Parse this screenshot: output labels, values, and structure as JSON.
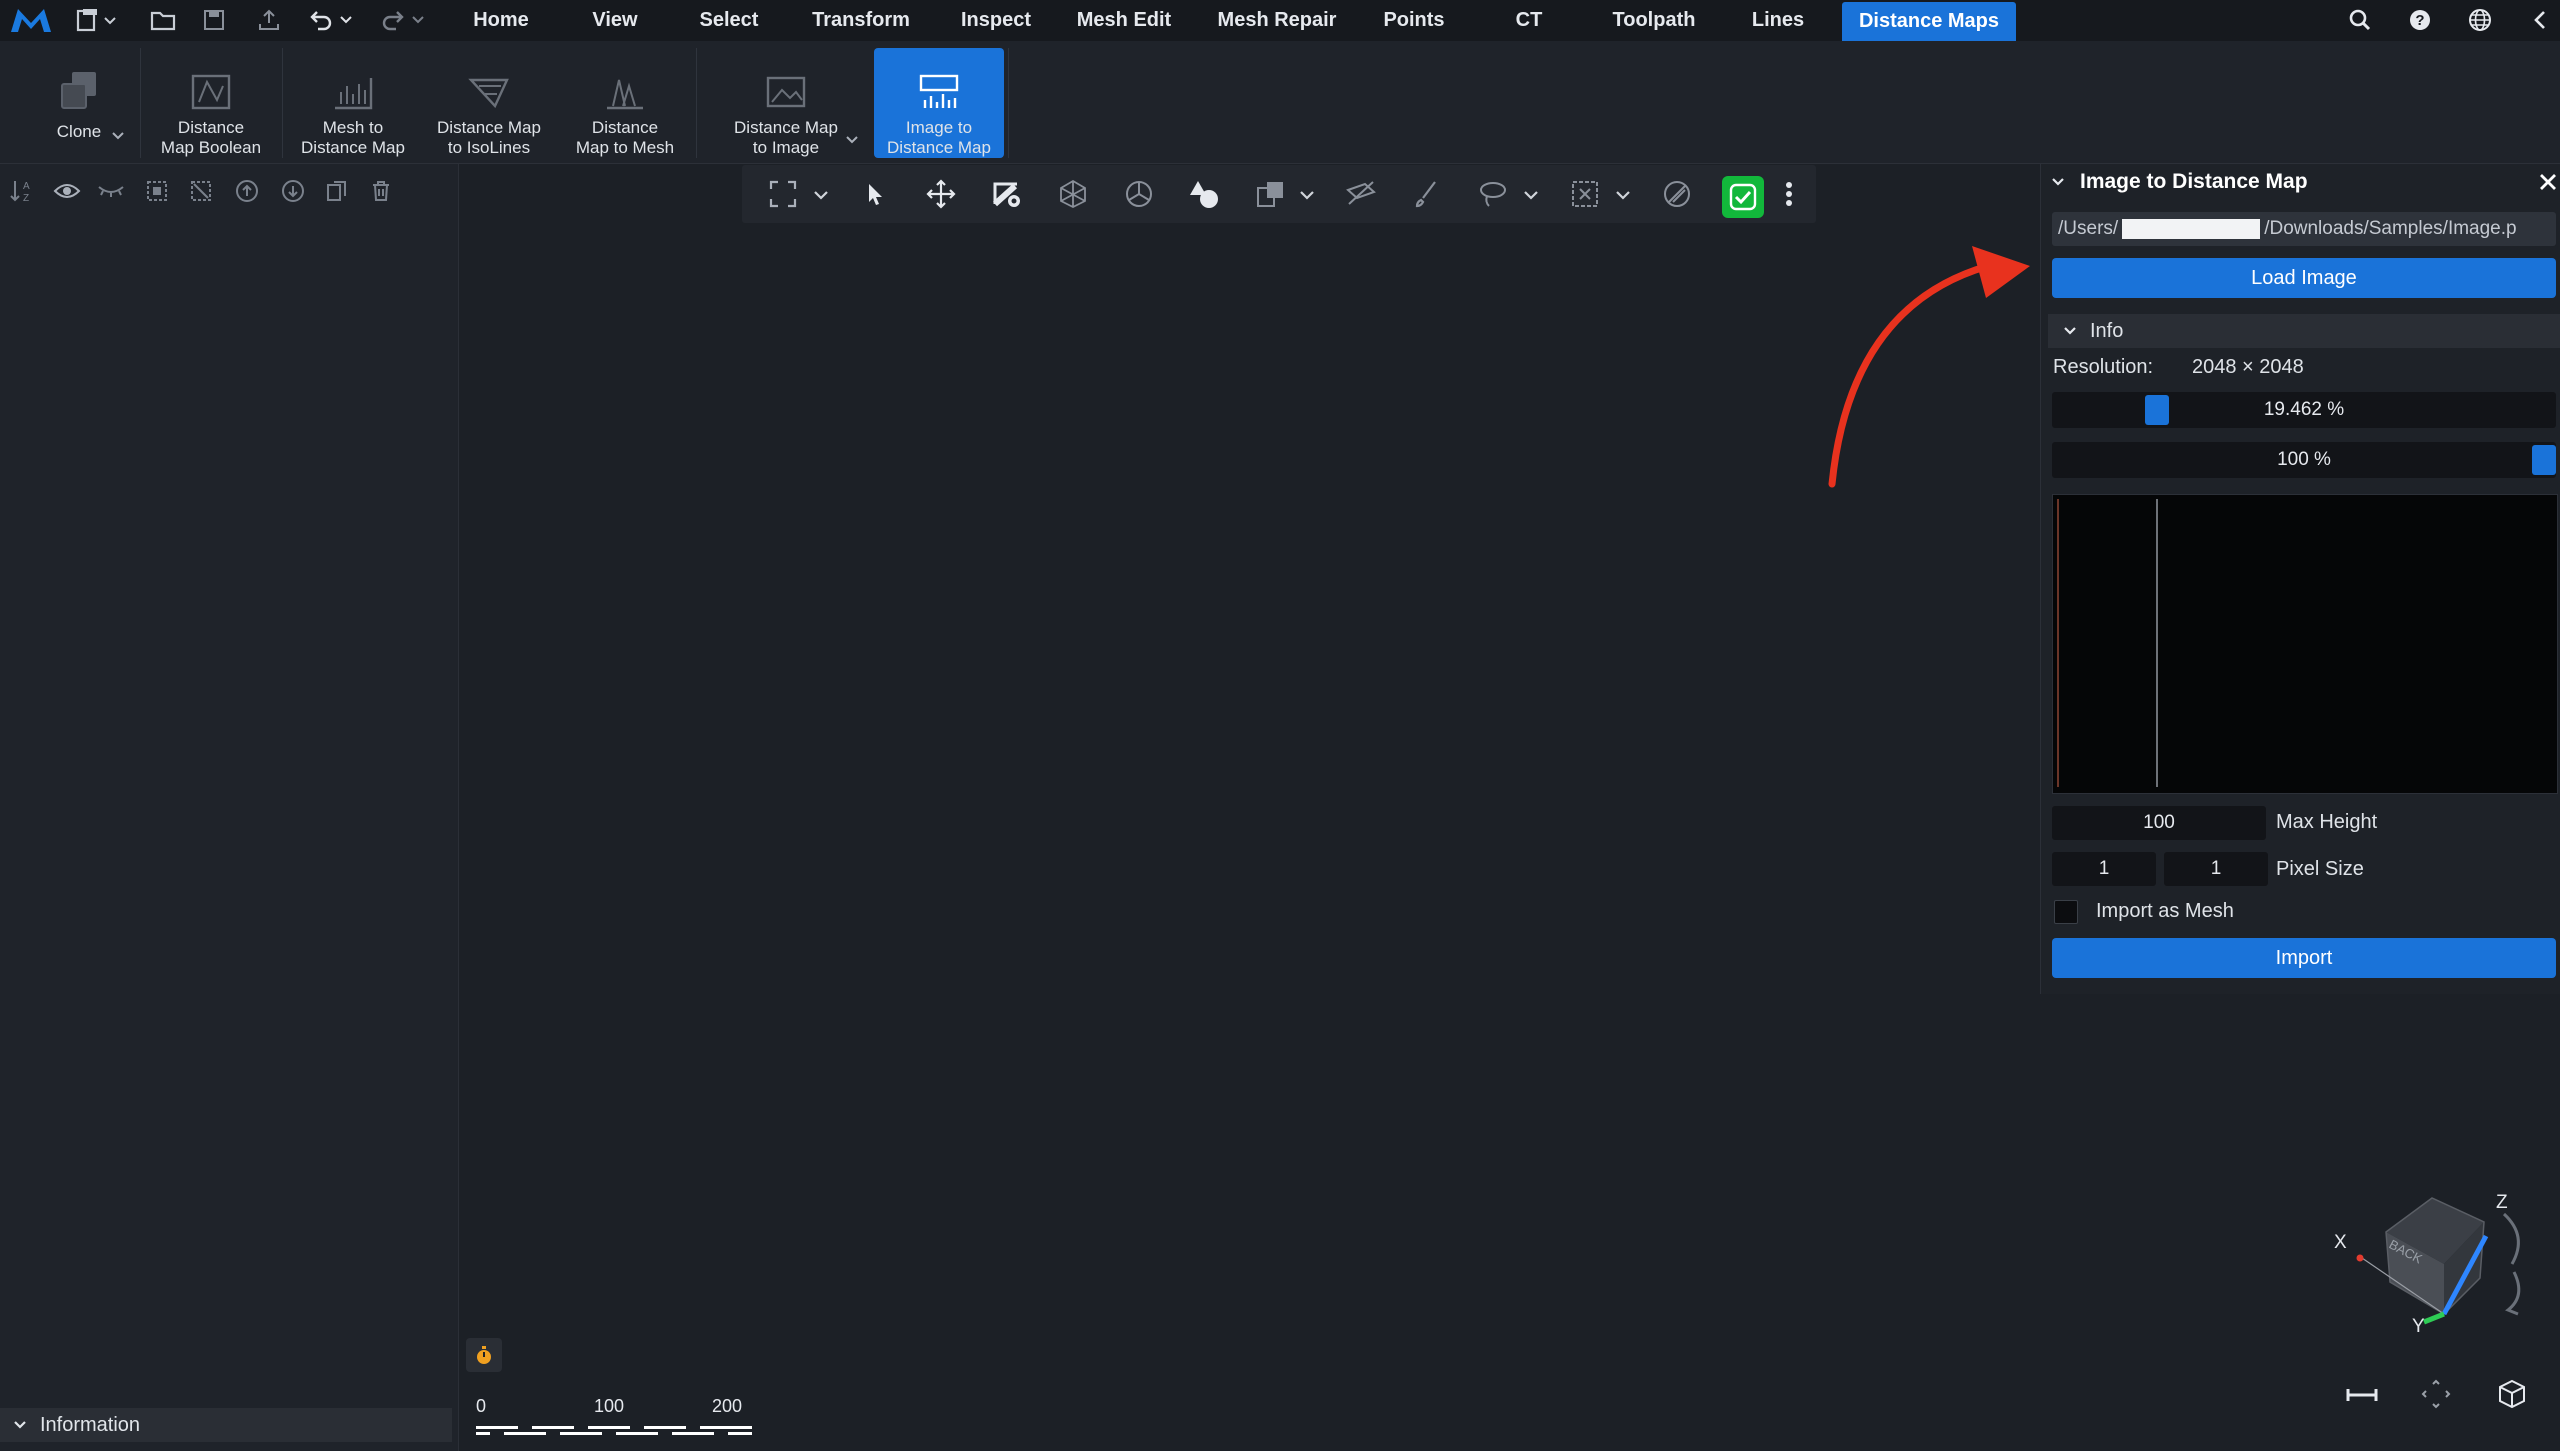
{
  "menu": {
    "tabs": [
      {
        "label": "Home"
      },
      {
        "label": "View"
      },
      {
        "label": "Select"
      },
      {
        "label": "Transform"
      },
      {
        "label": "Inspect"
      },
      {
        "label": "Mesh Edit"
      },
      {
        "label": "Mesh Repair"
      },
      {
        "label": "Points"
      },
      {
        "label": "CT"
      },
      {
        "label": "Toolpath"
      },
      {
        "label": "Lines"
      },
      {
        "label": "Distance Maps"
      }
    ],
    "active_tab": "Distance Maps"
  },
  "ribbon": {
    "buttons": [
      {
        "line1": "Clone",
        "line2": ""
      },
      {
        "line1": "Distance",
        "line2": "Map Boolean"
      },
      {
        "line1": "Mesh to",
        "line2": "Distance Map"
      },
      {
        "line1": "Distance Map",
        "line2": "to IsoLines"
      },
      {
        "line1": "Distance",
        "line2": "Map to Mesh"
      },
      {
        "line1": "Distance Map",
        "line2": "to Image"
      },
      {
        "line1": "Image to",
        "line2": "Distance Map"
      }
    ],
    "active": "Image to Distance Map"
  },
  "left_panel": {
    "information_label": "Information"
  },
  "scale_bar": {
    "ticks": [
      "0",
      "100",
      "200"
    ]
  },
  "panel": {
    "title": "Image to Distance Map",
    "path_prefix": "/Users/",
    "path_suffix": "/Downloads/Samples/Image.p",
    "load_button": "Load Image",
    "info_section": "Info",
    "resolution_label": "Resolution:",
    "resolution_value": "2048 × 2048",
    "slider1_text": "19.462 %",
    "slider1_value": 0.19462,
    "slider2_text": "100 %",
    "slider2_value": 1.0,
    "max_height_value": "100",
    "max_height_label": "Max Height",
    "pixel_size_x": "1",
    "pixel_size_y": "1",
    "pixel_size_label": "Pixel Size",
    "import_as_mesh_label": "Import as Mesh",
    "import_as_mesh_checked": false,
    "import_button": "Import"
  },
  "navcube": {
    "face_label": "BACK",
    "axis_x": "X",
    "axis_y": "Y",
    "axis_z": "Z"
  },
  "colors": {
    "accent": "#1a73d9",
    "green_toggle": "#12b83b",
    "arrow": "#e8321e"
  }
}
